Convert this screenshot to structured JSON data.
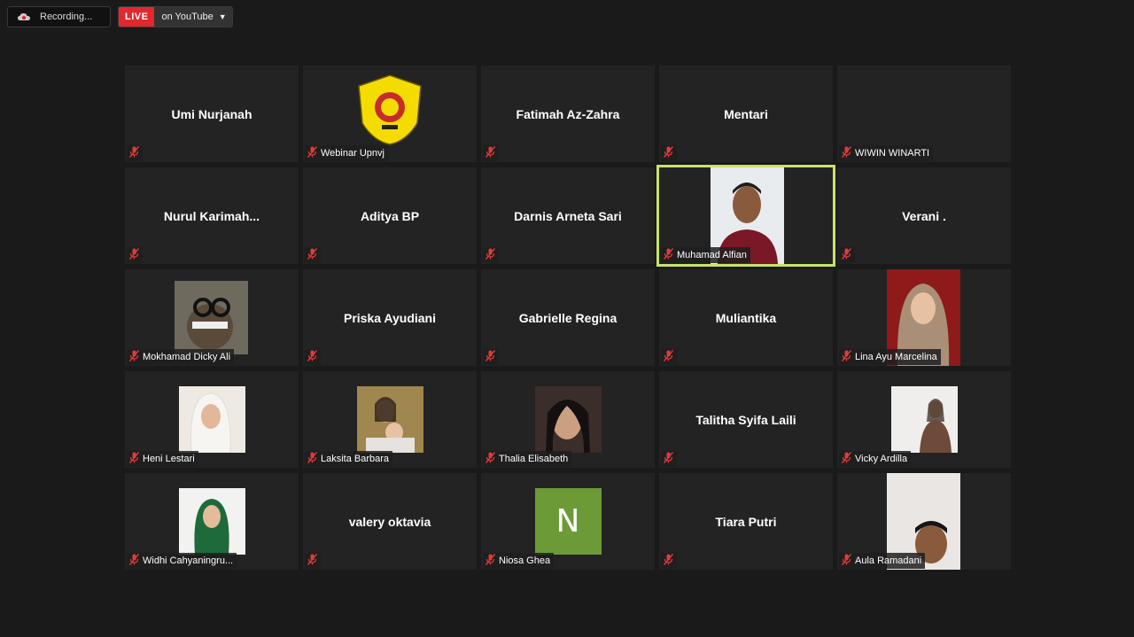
{
  "topbar": {
    "recording_label": "Recording...",
    "live_badge": "LIVE",
    "live_destination": "on YouTube"
  },
  "participants": [
    {
      "name": "Umi Nurjanah",
      "display": "Umi Nurjanah",
      "footer": ""
    },
    {
      "name": "Webinar Upnvj",
      "display": "",
      "footer": "Webinar Upnvj"
    },
    {
      "name": "Fatimah Az-Zahra",
      "display": "Fatimah Az-Zahra",
      "footer": ""
    },
    {
      "name": "Mentari",
      "display": "Mentari",
      "footer": ""
    },
    {
      "name": "WIWIN WINARTI",
      "display": "",
      "footer": "WIWIN WINARTI"
    },
    {
      "name": "Nurul Karimah...",
      "display": "Nurul  Karimah...",
      "footer": ""
    },
    {
      "name": "Aditya BP",
      "display": "Aditya BP",
      "footer": ""
    },
    {
      "name": "Darnis Arneta Sari",
      "display": "Darnis Arneta Sari",
      "footer": ""
    },
    {
      "name": "Muhamad Alfian",
      "display": "",
      "footer": "Muhamad Alfian"
    },
    {
      "name": "Verani .",
      "display": "Verani .",
      "footer": ""
    },
    {
      "name": "Mokhamad Dicky Ali",
      "display": "",
      "footer": "Mokhamad Dicky Ali"
    },
    {
      "name": "Priska Ayudiani",
      "display": "Priska Ayudiani",
      "footer": ""
    },
    {
      "name": "Gabrielle Regina",
      "display": "Gabrielle Regina",
      "footer": ""
    },
    {
      "name": "Muliantika",
      "display": "Muliantika",
      "footer": ""
    },
    {
      "name": "Lina Ayu Marcelina",
      "display": "",
      "footer": "Lina Ayu Marcelina"
    },
    {
      "name": "Heni Lestari",
      "display": "",
      "footer": "Heni Lestari"
    },
    {
      "name": "Laksita Barbara",
      "display": "",
      "footer": "Laksita Barbara"
    },
    {
      "name": "Thalia Elisabeth",
      "display": "",
      "footer": "Thalia Elisabeth"
    },
    {
      "name": "Talitha Syifa Laili",
      "display": "Talitha Syifa Laili",
      "footer": ""
    },
    {
      "name": "Vicky Ardilla",
      "display": "",
      "footer": "Vicky Ardilla"
    },
    {
      "name": "Widhi Cahyaningru...",
      "display": "",
      "footer": "Widhi Cahyaningru..."
    },
    {
      "name": "valery oktavia",
      "display": "valery oktavia",
      "footer": ""
    },
    {
      "name": "Niosa Ghea",
      "display": "",
      "footer": "Niosa Ghea",
      "avatar_letter": "N"
    },
    {
      "name": "Tiara Putri",
      "display": "Tiara Putri",
      "footer": ""
    },
    {
      "name": "Aula Ramadani",
      "display": "",
      "footer": "Aula Ramadani"
    }
  ],
  "colors": {
    "background": "#1a1a1a",
    "tile": "#232323",
    "active_speaker_border": "#c8e36a",
    "live_badge": "#e2282f",
    "muted_icon": "#e23b3b",
    "avatar_n": "#6c9a37"
  },
  "icons": {
    "recording": "cloud-record-icon",
    "muted": "mic-muted-icon",
    "dropdown": "chevron-down-icon"
  }
}
